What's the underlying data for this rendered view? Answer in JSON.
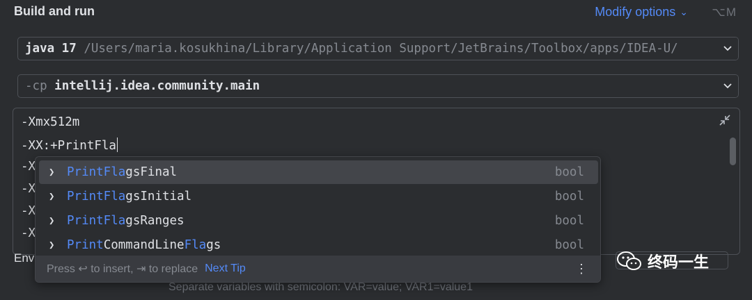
{
  "header": {
    "title": "Build and run",
    "modify_label": "Modify options",
    "shortcut": "⌥M"
  },
  "jdk": {
    "version": "java 17",
    "path": "/Users/maria.kosukhina/Library/Application Support/JetBrains/Toolbox/apps/IDEA-U/"
  },
  "classpath": {
    "flag": "-cp",
    "module": "intellij.idea.community.main"
  },
  "vm_options": {
    "lines": [
      "-Xmx512m",
      "-XX:+PrintFla",
      "-X",
      "-X",
      "-X",
      "-X"
    ]
  },
  "completion": {
    "items": [
      {
        "prefix": "PrintFla",
        "rest": "gsFinal",
        "type": "bool"
      },
      {
        "prefix": "PrintFla",
        "rest": "gsInitial",
        "type": "bool"
      },
      {
        "prefix": "PrintFla",
        "rest": "gsRanges",
        "type": "bool"
      },
      {
        "p1": "Print",
        "mid": "CommandLine",
        "p2": "Fla",
        "end": "gs",
        "type": "bool"
      }
    ],
    "footer_text": "Press ↩ to insert, ⇥ to replace",
    "next_tip": "Next Tip",
    "more": "⋮"
  },
  "env": {
    "label_partial": "Env",
    "hint": "Separate variables with semicolon: VAR=value; VAR1=value1"
  },
  "watermark": {
    "text": "终码一生"
  },
  "colors": {
    "background": "#2b2d30",
    "accent": "#548af7",
    "muted": "#868a91"
  }
}
